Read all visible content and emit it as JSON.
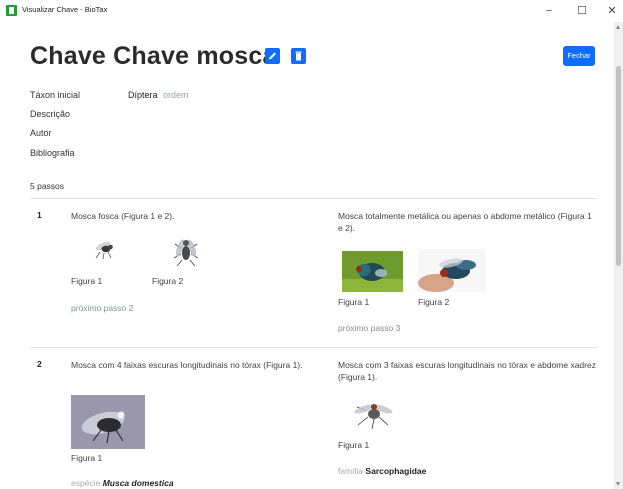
{
  "window": {
    "title": "Visualizar Chave - BioTax",
    "minimize": "−",
    "maximize": "☐",
    "close": "✕"
  },
  "header": {
    "title": "Chave Chave mosca",
    "close_label": "Fechar"
  },
  "details": {
    "initial_taxon_label": "Táxon inicial",
    "initial_taxon_name": "Díptera",
    "initial_taxon_rank": "ordem",
    "description_label": "Descrição",
    "author_label": "Autor",
    "bibliography_label": "Bibliografia"
  },
  "steps_count": "5 passos",
  "steps": [
    {
      "number": "1",
      "left": {
        "text": "Mosca fosca (Figura 1 e 2).",
        "figures": [
          "Figura 1",
          "Figura 2"
        ],
        "next": "próximo passo 2"
      },
      "right": {
        "text": "Mosca totalmente metálica ou apenas o abdome metálico (Figura 1 e 2).",
        "figures": [
          "Figura 1",
          "Figura 2"
        ],
        "next": "próximo passo 3"
      }
    },
    {
      "number": "2",
      "left": {
        "text": "Mosca com 4 faixas escuras longitudinais no tórax (Figura 1).",
        "figures": [
          "Figura 1"
        ],
        "taxon_rank": "espécie",
        "taxon_name": "Musca domestica"
      },
      "right": {
        "text": "Mosca com 3 faixas escuras longitudinais no tórax e abdome xadrez (Figura 1).",
        "figures": [
          "Figura 1"
        ],
        "taxon_rank": "família",
        "taxon_name": "Sarcophagidae"
      }
    }
  ],
  "colors": {
    "primary": "#0d6efd",
    "muted": "#9aa0a6",
    "app_icon": "#1e9e3a"
  }
}
